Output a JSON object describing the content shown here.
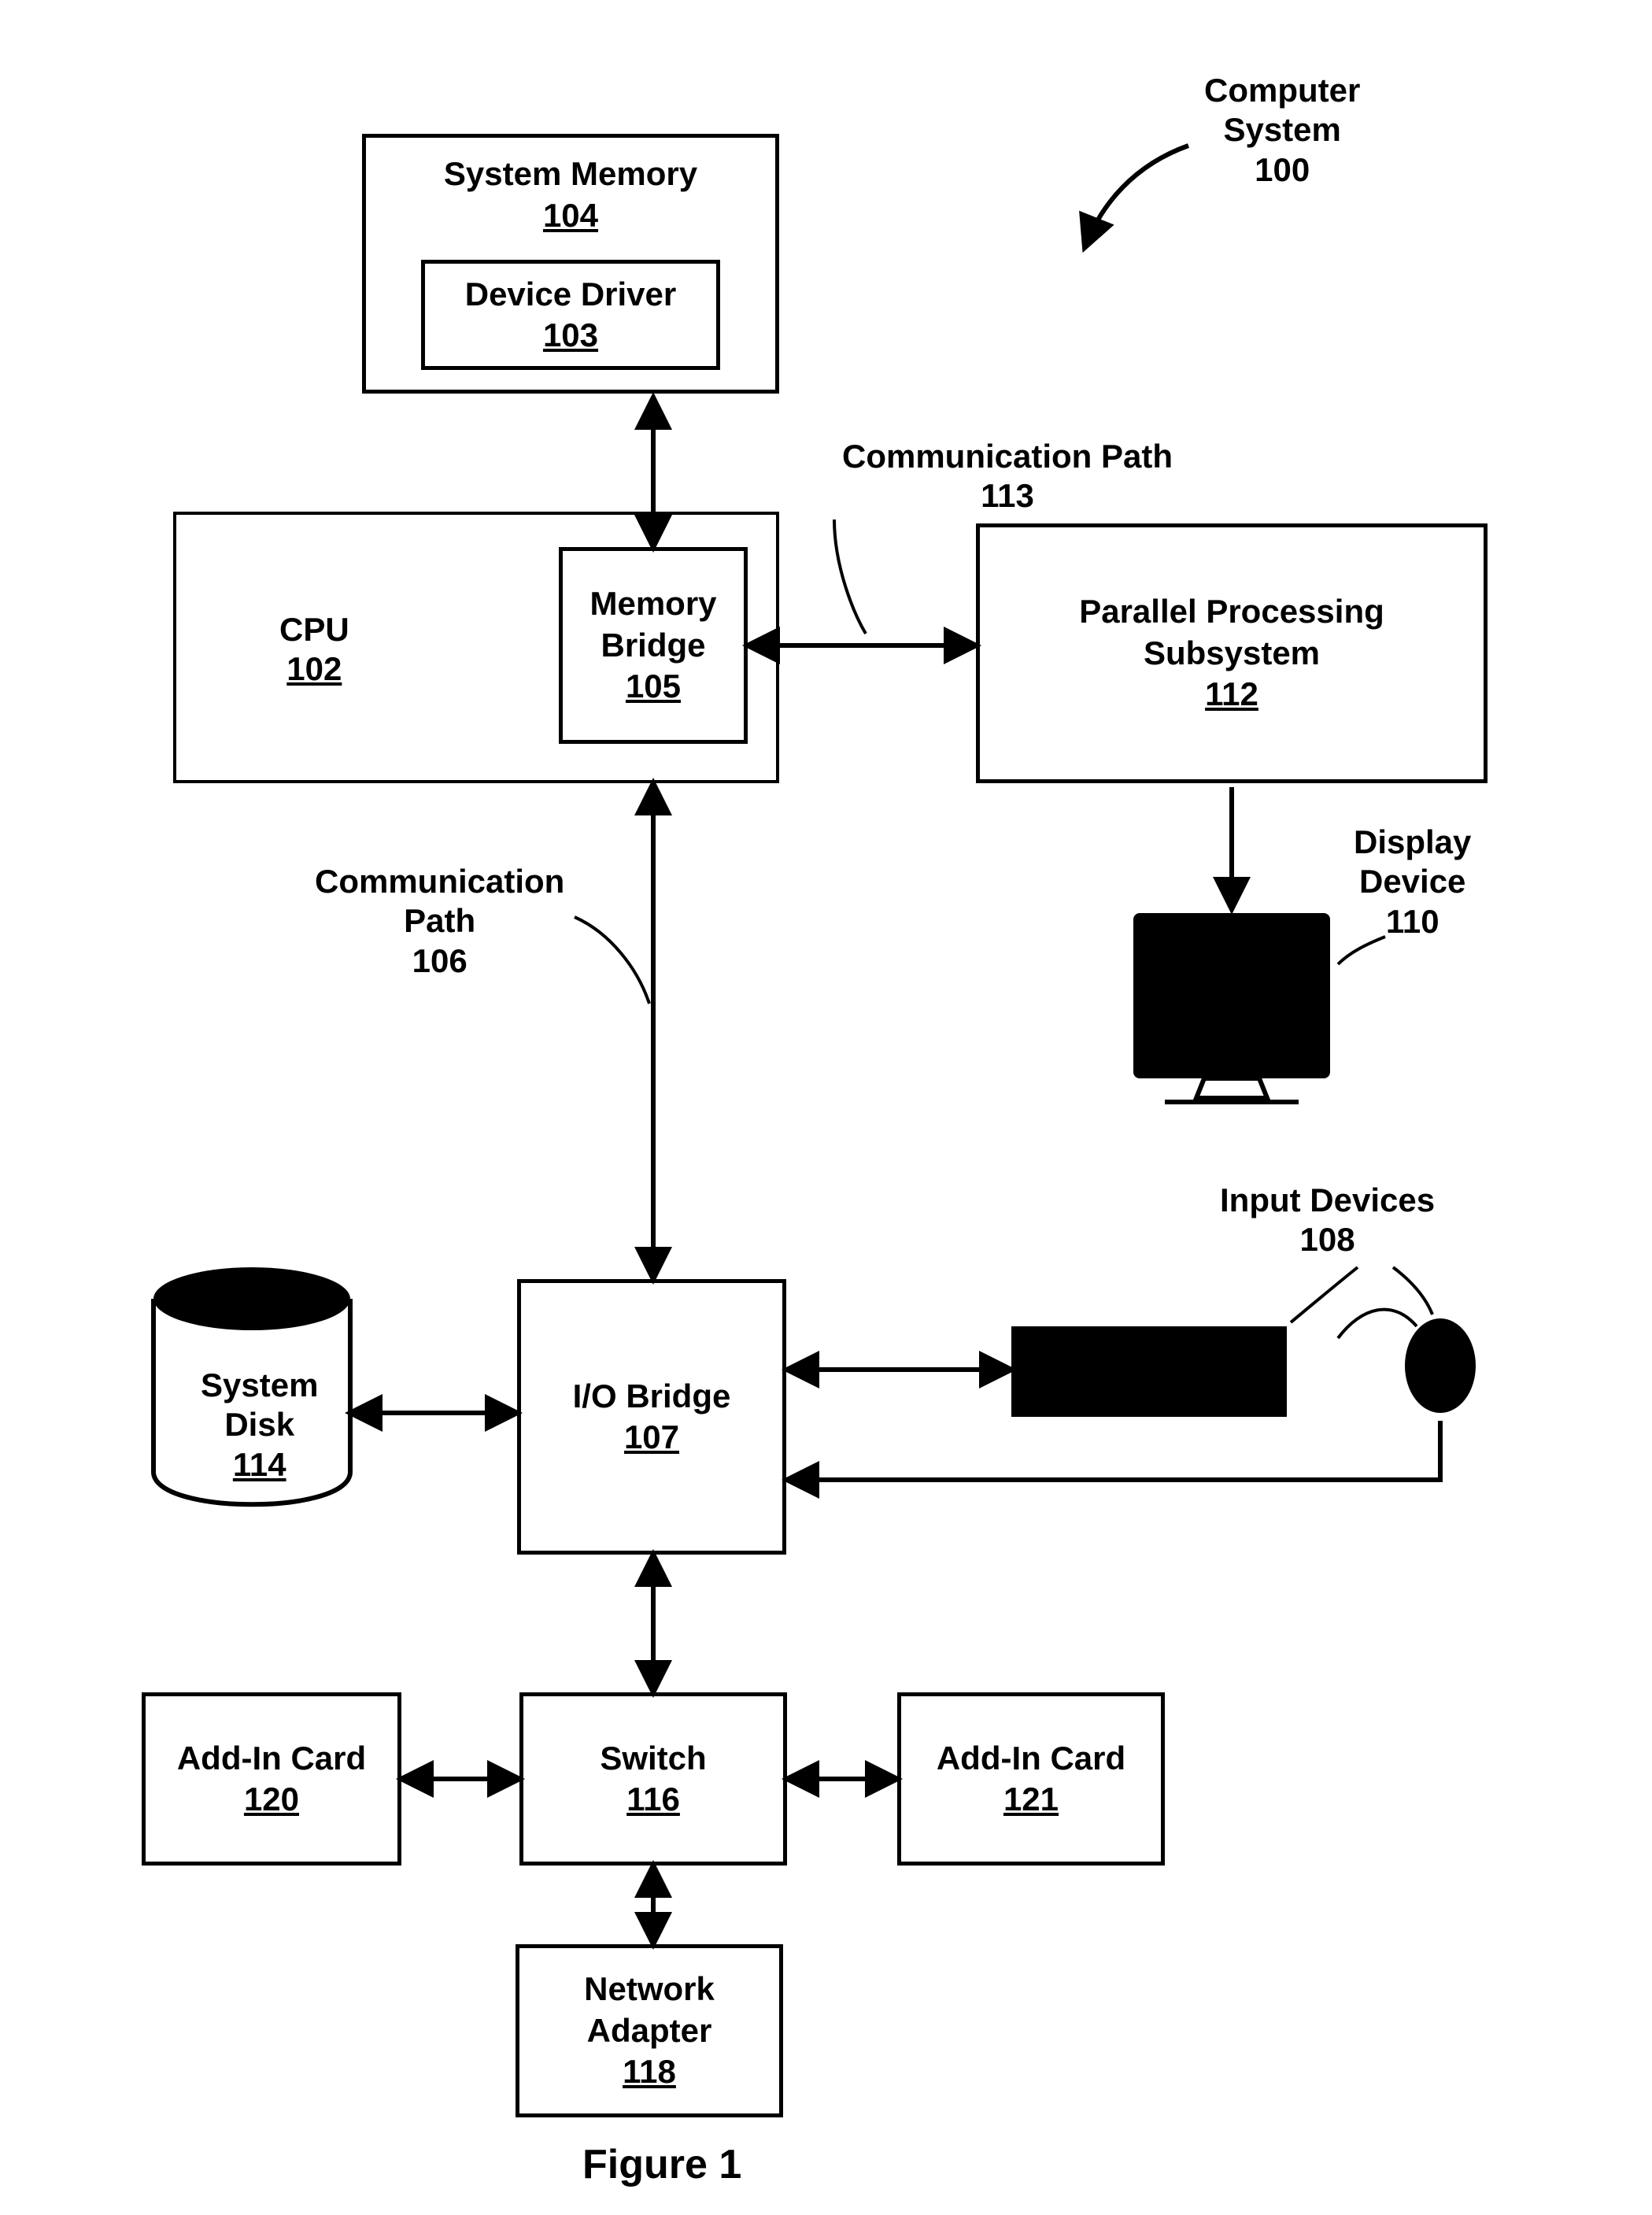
{
  "figure_caption": "Figure 1",
  "title_label": {
    "line1": "Computer",
    "line2": "System",
    "num": "100"
  },
  "system_memory": {
    "name": "System Memory",
    "num": "104"
  },
  "device_driver": {
    "name": "Device Driver",
    "num": "103"
  },
  "cpu": {
    "name": "CPU",
    "num": "102"
  },
  "memory_bridge": {
    "name": "Memory",
    "name2": "Bridge",
    "num": "105"
  },
  "comm_path_113": {
    "name": "Communication Path",
    "num": "113"
  },
  "pps": {
    "name": "Parallel Processing",
    "name2": "Subsystem",
    "num": "112"
  },
  "display_device": {
    "name": "Display",
    "name2": "Device",
    "num": "110"
  },
  "comm_path_106": {
    "name": "Communication",
    "name2": "Path",
    "num": "106"
  },
  "io_bridge": {
    "name": "I/O Bridge",
    "num": "107"
  },
  "system_disk": {
    "name": "System",
    "name2": "Disk",
    "num": "114"
  },
  "input_devices": {
    "name": "Input Devices",
    "num": "108"
  },
  "switch": {
    "name": "Switch",
    "num": "116"
  },
  "addin_l": {
    "name": "Add-In Card",
    "num": "120"
  },
  "addin_r": {
    "name": "Add-In Card",
    "num": "121"
  },
  "net_adapter": {
    "name": "Network",
    "name2": "Adapter",
    "num": "118"
  }
}
